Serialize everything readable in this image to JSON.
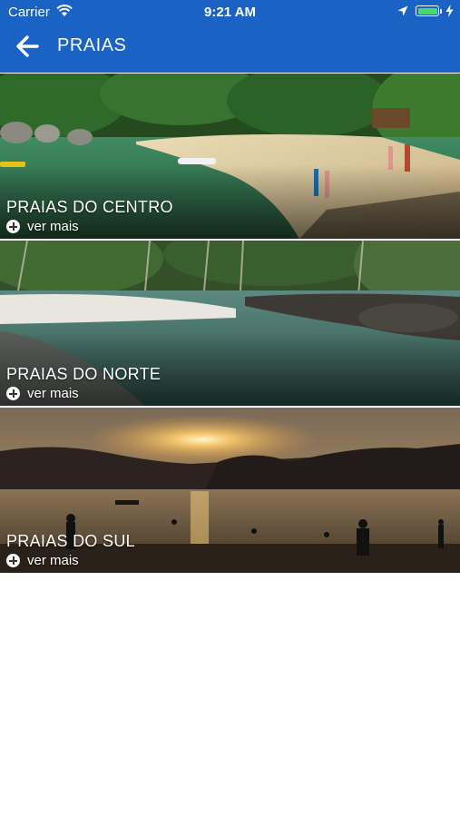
{
  "status_bar": {
    "carrier": "Carrier",
    "time": "9:21 AM",
    "battery_level": 1.0
  },
  "navbar": {
    "title": "PRAIAS",
    "back_icon": "arrow-left-icon"
  },
  "cards": [
    {
      "title": "PRAIAS DO CENTRO",
      "more_label": "ver mais",
      "icon": "plus-circle-icon"
    },
    {
      "title": "PRAIAS DO NORTE",
      "more_label": "ver mais",
      "icon": "plus-circle-icon"
    },
    {
      "title": "PRAIAS DO SUL",
      "more_label": "ver mais",
      "icon": "plus-circle-icon"
    }
  ],
  "colors": {
    "header": "#1a63c5",
    "battery": "#4cd964"
  }
}
